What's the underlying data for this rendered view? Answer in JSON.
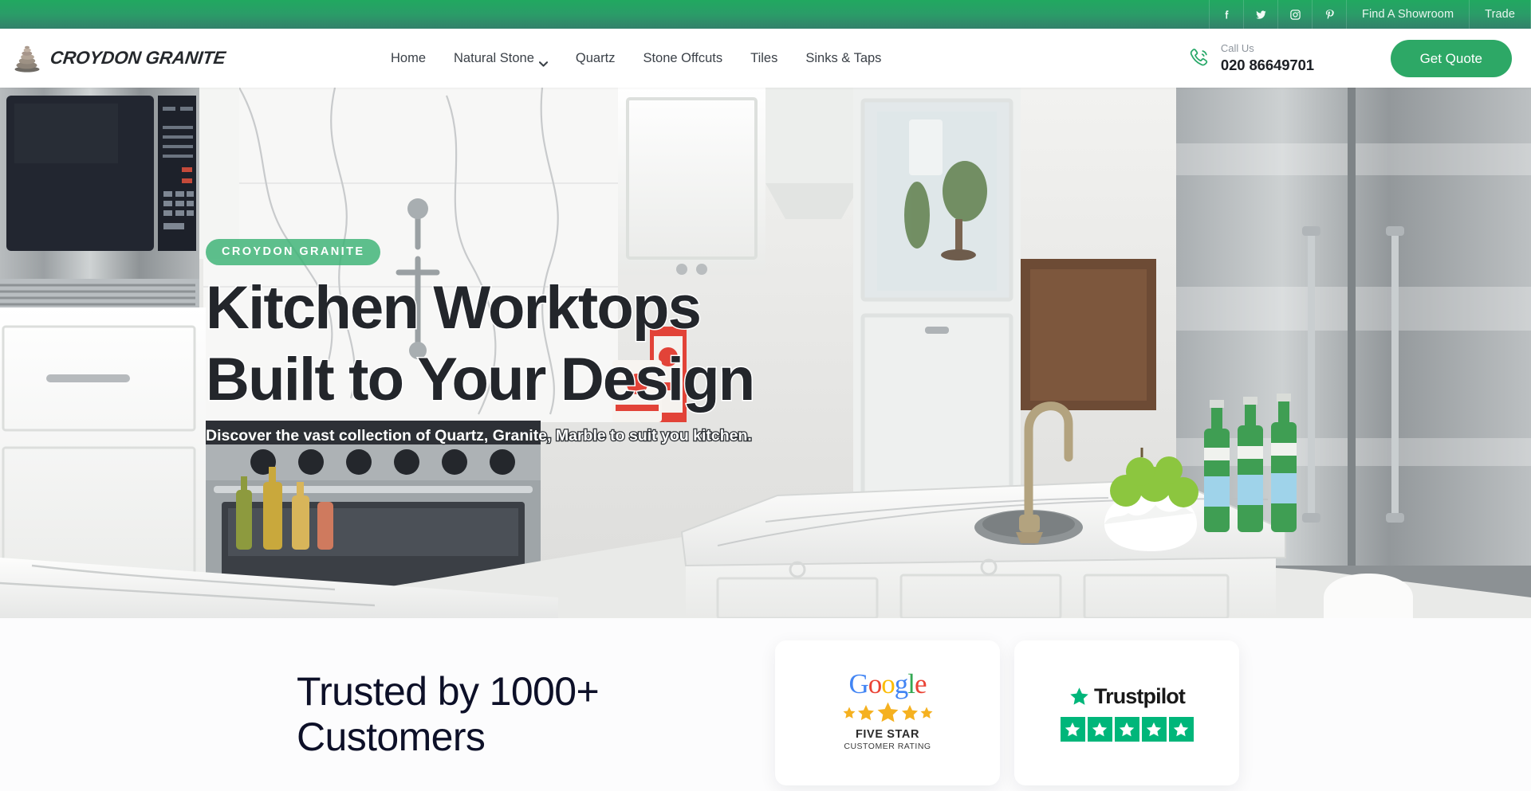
{
  "topbar": {
    "social": [
      {
        "name": "facebook-icon",
        "label": "Facebook"
      },
      {
        "name": "twitter-icon",
        "label": "Twitter"
      },
      {
        "name": "instagram-icon",
        "label": "Instagram"
      },
      {
        "name": "pinterest-icon",
        "label": "Pinterest"
      }
    ],
    "links": [
      {
        "label": "Find A Showroom"
      },
      {
        "label": "Trade"
      }
    ],
    "gradient_from": "#21a860",
    "gradient_to": "#33806a"
  },
  "header": {
    "brand_name": "CROYDON GRANITE",
    "logo_icon": "stacked-stones-icon",
    "nav": [
      {
        "label": "Home",
        "has_dropdown": false
      },
      {
        "label": "Natural Stone",
        "has_dropdown": true
      },
      {
        "label": "Quartz",
        "has_dropdown": false
      },
      {
        "label": "Stone Offcuts",
        "has_dropdown": false
      },
      {
        "label": "Tiles",
        "has_dropdown": false
      },
      {
        "label": "Sinks & Taps",
        "has_dropdown": false
      }
    ],
    "call_label": "Call Us",
    "call_number": "020 86649701",
    "quote_button": "Get Quote",
    "accent_color": "#2da866"
  },
  "hero": {
    "badge": "CROYDON GRANITE",
    "title_line1": "Kitchen Worktops",
    "title_line2": "Built to Your Design",
    "subtitle": "Discover the vast collection of Quartz, Granite, Marble to suit you kitchen.",
    "image_description": "Luxury white kitchen with marble worktops, island sink and stainless steel appliances"
  },
  "trust": {
    "title_line1": "Trusted by 1000+",
    "title_line2": "Customers",
    "cards": [
      {
        "provider": "Google",
        "logo_letters": [
          "G",
          "o",
          "o",
          "g",
          "l",
          "e"
        ],
        "stars": 5,
        "heading": "FIVE STAR",
        "subheading": "CUSTOMER RATING"
      },
      {
        "provider": "Trustpilot",
        "logo_text": "Trustpilot",
        "stars": 5,
        "star_color": "#00b67a"
      }
    ]
  }
}
